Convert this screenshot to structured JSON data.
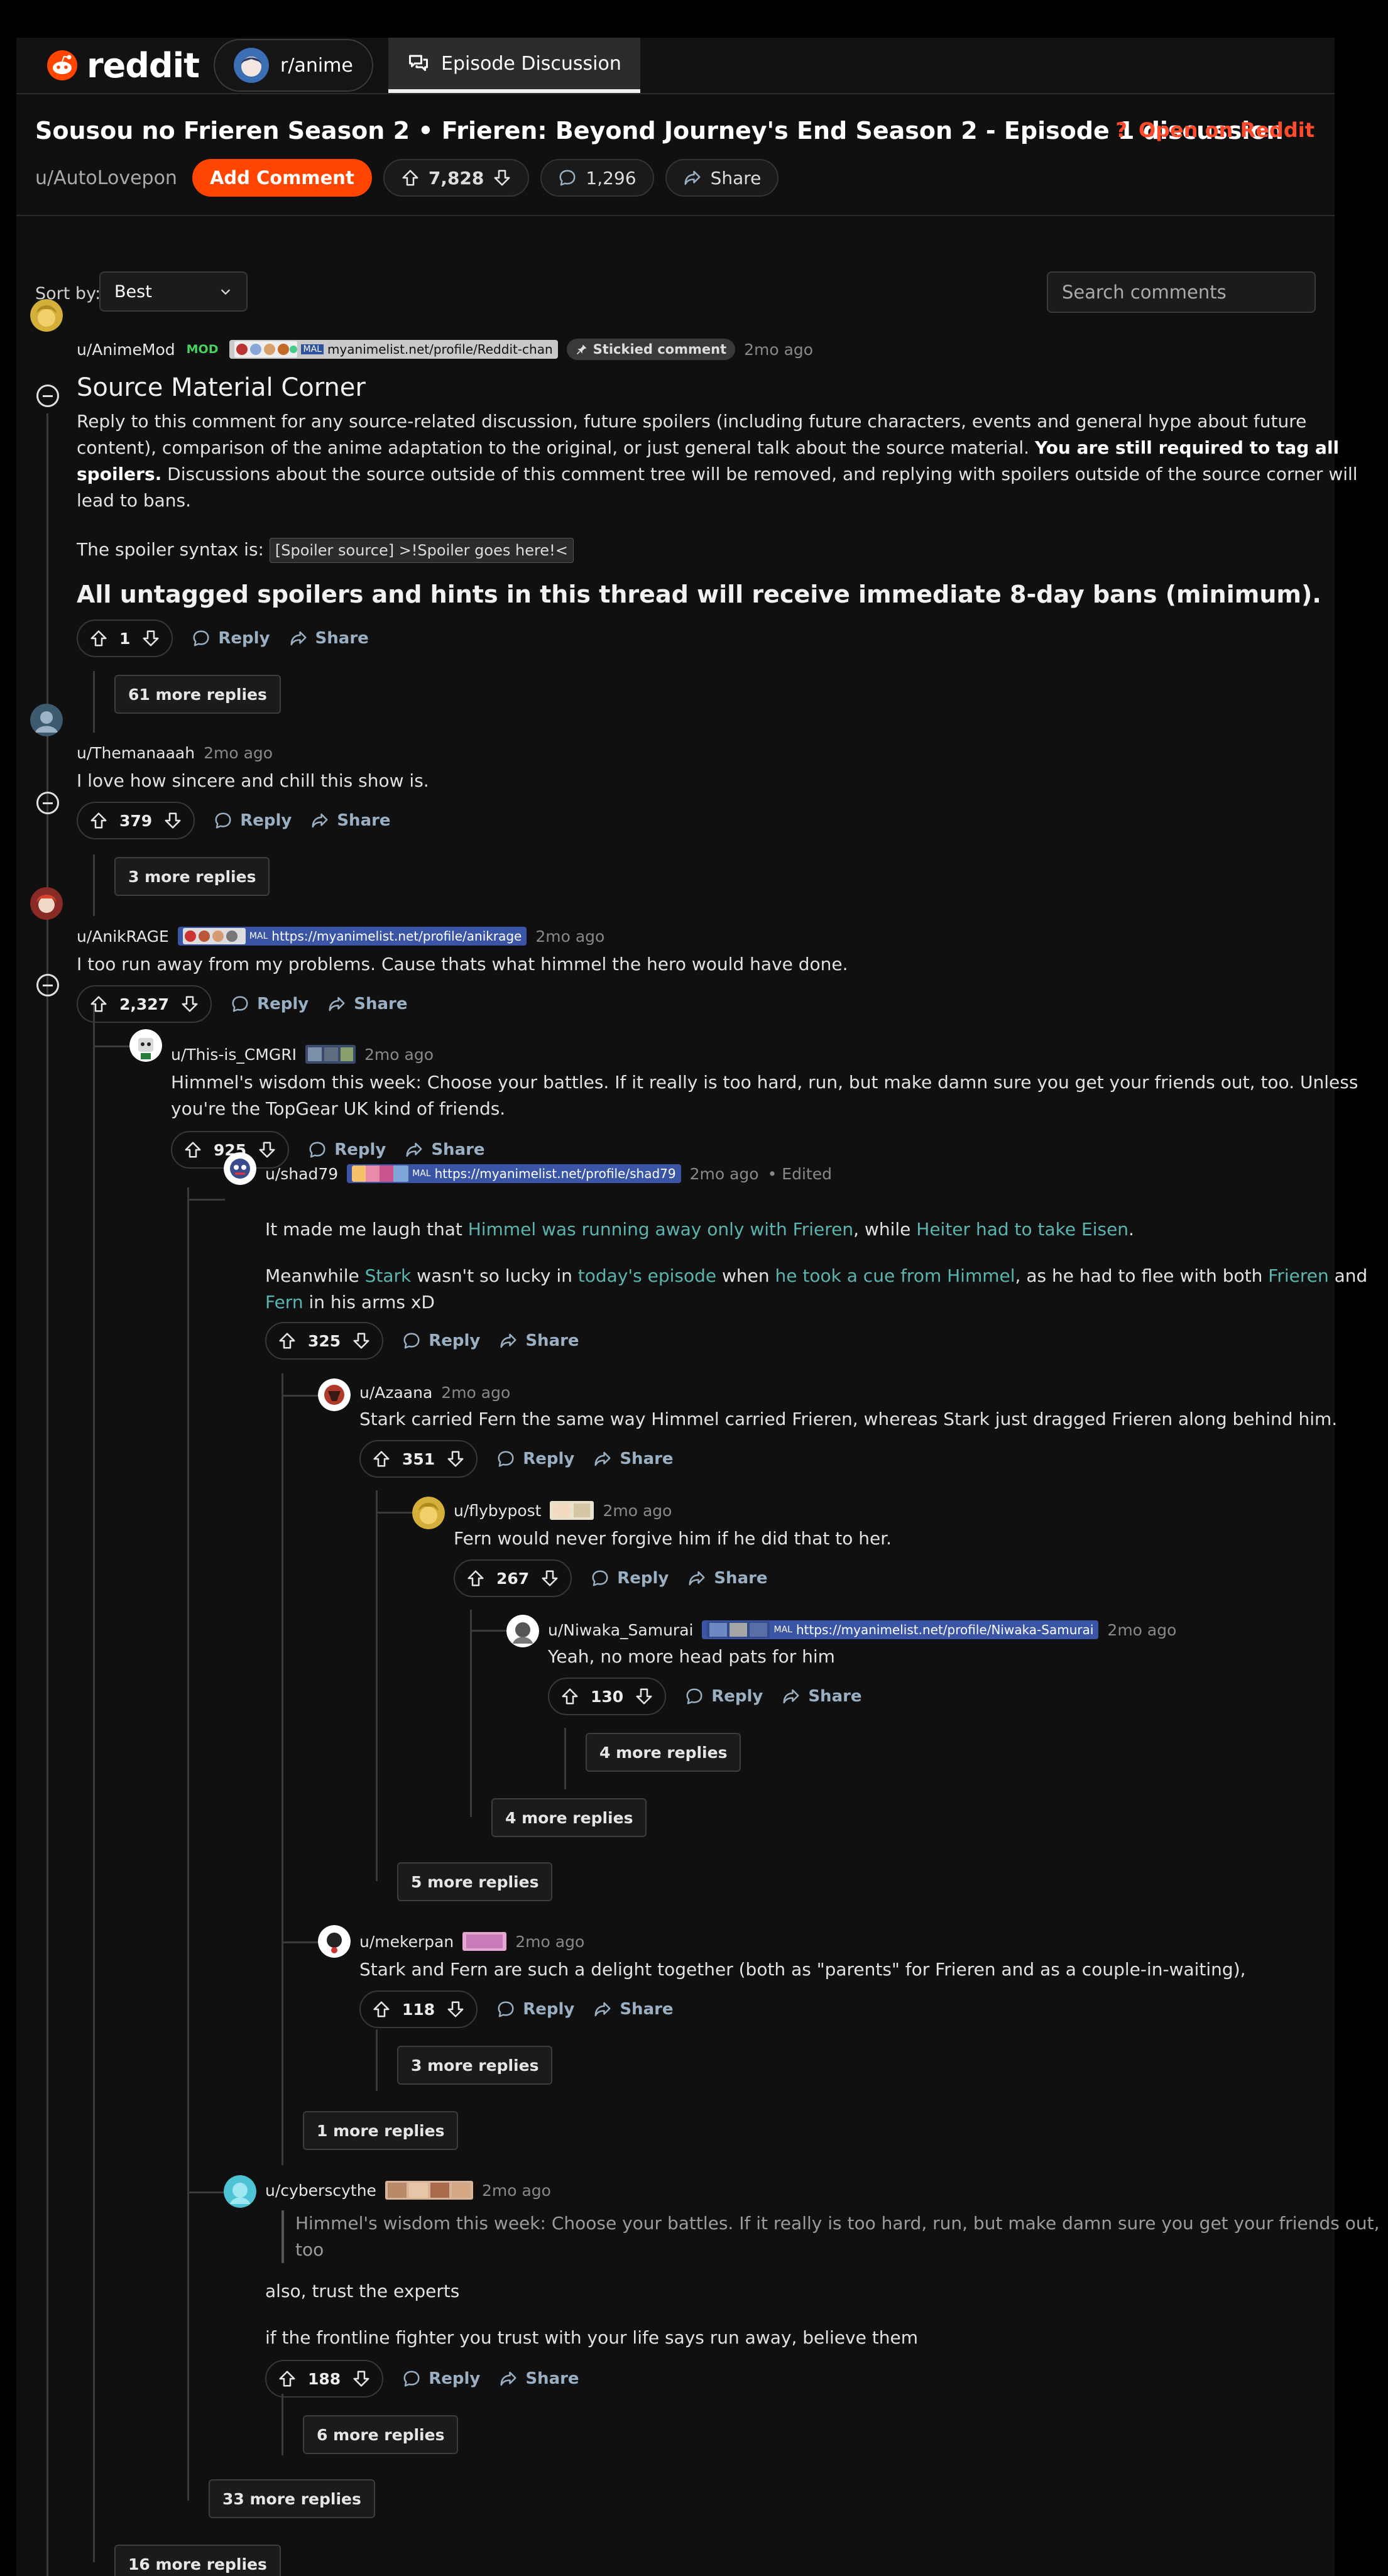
{
  "topbar": {
    "logo_text": "reddit",
    "subreddit_tab": "r/anime",
    "discussion_tab": "Episode Discussion"
  },
  "post": {
    "title": "Sousou no Frieren Season 2 • Frieren: Beyond Journey's End Season 2 - Episode 1 discussion",
    "open_on_reddit": "Open on Reddit",
    "author": "u/AutoLovepon",
    "add_comment": "Add Comment",
    "upvotes": "7,828",
    "comments": "1,296",
    "share": "Share"
  },
  "controls": {
    "sort_label": "Sort by:",
    "sort_value": "Best",
    "search_placeholder": "Search comments"
  },
  "labels": {
    "reply": "Reply",
    "share": "Share",
    "mod": "MOD",
    "stickied": "Stickied comment",
    "edited": "• Edited"
  },
  "comments": {
    "animemod": {
      "user": "u/AnimeMod",
      "time": "2mo ago",
      "flair": "myanimelist.net/profile/Reddit-chan",
      "heading": "Source Material Corner",
      "p1_l1": "Reply to this comment for any source-related discussion, future spoilers (including future characters, events and general hype about future",
      "p1_l2a": "content), comparison of the anime adaptation to the original, or just general talk about the source material. ",
      "p1_l2b": "You are still required to tag all",
      "p1_l3a": "spoilers.",
      "p1_l3b": " Discussions about the source outside of this comment tree will be removed, and replying with spoilers outside of the source corner will",
      "p1_l4": "lead to bans.",
      "syntax_label": "The spoiler syntax is: ",
      "syntax_code": "[Spoiler source] >!Spoiler goes here!<",
      "warning": "All untagged spoilers and hints in this thread will receive immediate 8-day bans (minimum).",
      "score": "1",
      "more": "61 more replies"
    },
    "themanaaah": {
      "user": "u/Themanaaah",
      "time": "2mo ago",
      "text": "I love how sincere and chill this show is.",
      "score": "379",
      "more": "3 more replies"
    },
    "anikrage": {
      "user": "u/AnikRAGE",
      "time": "2mo ago",
      "flair": "https://myanimelist.net/profile/anikrage",
      "text": "I too run away from my problems. Cause thats what himmel the hero would have done.",
      "score": "2,327",
      "more": "16 more replies"
    },
    "cmgri": {
      "user": "u/This-is_CMGRI",
      "time": "2mo ago",
      "line1": "Himmel's wisdom this week: Choose your battles. If it really is too hard, run, but make damn sure you get your friends out, too. Unless",
      "line2": "you're the TopGear UK kind of friends.",
      "score": "925",
      "more": "33 more replies"
    },
    "shad79": {
      "user": "u/shad79",
      "time": "2mo ago",
      "flair": "https://myanimelist.net/profile/shad79",
      "l1a": "It made me laugh that ",
      "l1b": "Himmel was running away only with Frieren",
      "l1c": ", while ",
      "l1d": "Heiter had to take Eisen",
      "l1e": ".",
      "l2a": "Meanwhile ",
      "l2b": "Stark",
      "l2c": " wasn't so lucky in ",
      "l2d": "today's episode",
      "l2e": " when ",
      "l2f": "he took a cue from Himmel",
      "l2g": ", as he had to flee with both ",
      "l2h": "Frieren",
      "l2i": " and",
      "l3a": "Fern",
      "l3b": " in his arms xD",
      "score": "325",
      "more": "1 more replies"
    },
    "azaana": {
      "user": "u/Azaana",
      "time": "2mo ago",
      "text": "Stark carried Fern the same way Himmel carried Frieren, whereas Stark just dragged Frieren along behind him.",
      "score": "351",
      "more": "5 more replies"
    },
    "flybypost": {
      "user": "u/flybypost",
      "time": "2mo ago",
      "text": "Fern would never forgive him if he did that to her.",
      "score": "267",
      "more": "4 more replies"
    },
    "niwaka": {
      "user": "u/Niwaka_Samurai",
      "time": "2mo ago",
      "flair": "https://myanimelist.net/profile/Niwaka-Samurai",
      "text": "Yeah, no more head pats for him",
      "score": "130",
      "more": "4 more replies"
    },
    "mekerpan": {
      "user": "u/mekerpan",
      "time": "2mo ago",
      "text": "Stark and Fern are such a delight together (both as \"parents\" for Frieren and as a couple-in-waiting),",
      "score": "118",
      "more": "3 more replies"
    },
    "cyberscythe": {
      "user": "u/cyberscythe",
      "time": "2mo ago",
      "quote1": "Himmel's wisdom this week: Choose your battles. If it really is too hard, run, but make damn sure you get your friends out,",
      "quote2": "too",
      "text1": "also, trust the experts",
      "text2": "if the frontline fighter you trust with your life says run away, believe them",
      "score": "188",
      "more": "6 more replies"
    }
  },
  "icons": {
    "reddit_logo": "reddit-logo-icon",
    "help": "question-icon",
    "upvote": "arrow-up-icon",
    "downvote": "arrow-down-icon",
    "reply": "speech-bubble-icon",
    "share": "share-arrow-icon",
    "pin": "pin-icon",
    "chevron": "chevron-down-icon"
  },
  "colors": {
    "accent": "#ff4500",
    "background": "#101010",
    "link": "#5ab5b0",
    "flair": "#3a55a5"
  }
}
